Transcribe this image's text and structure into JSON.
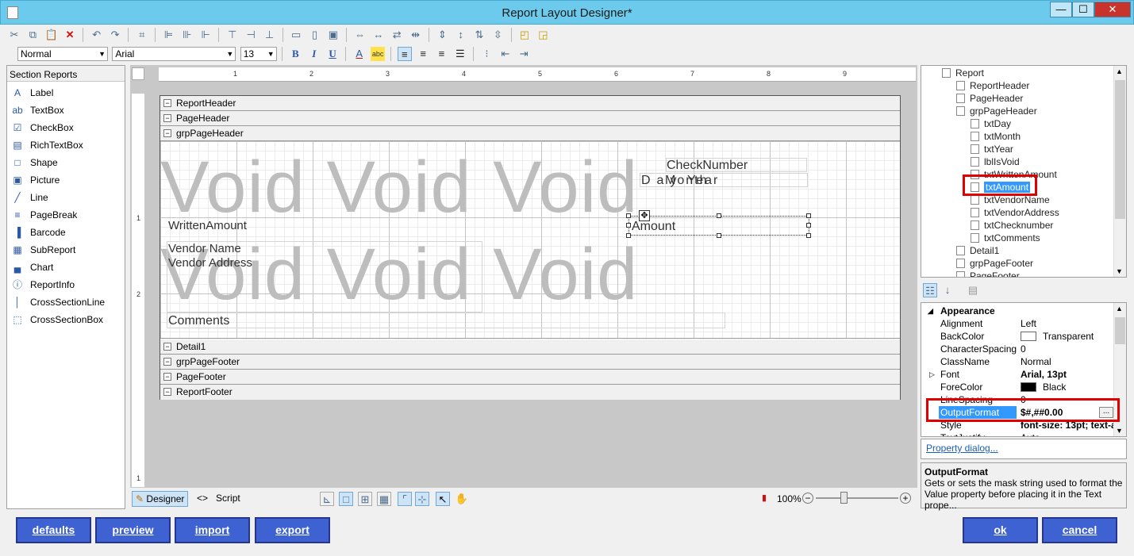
{
  "window": {
    "title": "Report Layout Designer*",
    "minimize": "—",
    "maximize": "☐",
    "close": "✕"
  },
  "format_bar": {
    "style": "Normal",
    "font": "Arial",
    "size": "13",
    "bold": "B",
    "italic": "I",
    "underline": "U"
  },
  "toolbox": {
    "header": "Section Reports",
    "items": [
      {
        "label": "Label",
        "icon": "label-icon",
        "glyph": "A"
      },
      {
        "label": "TextBox",
        "icon": "textbox-icon",
        "glyph": "ab"
      },
      {
        "label": "CheckBox",
        "icon": "checkbox-icon",
        "glyph": "☑"
      },
      {
        "label": "RichTextBox",
        "icon": "richtextbox-icon",
        "glyph": "▤"
      },
      {
        "label": "Shape",
        "icon": "shape-icon",
        "glyph": "□"
      },
      {
        "label": "Picture",
        "icon": "picture-icon",
        "glyph": "▣"
      },
      {
        "label": "Line",
        "icon": "line-icon",
        "glyph": "╱"
      },
      {
        "label": "PageBreak",
        "icon": "pagebreak-icon",
        "glyph": "≡"
      },
      {
        "label": "Barcode",
        "icon": "barcode-icon",
        "glyph": "▐"
      },
      {
        "label": "SubReport",
        "icon": "subreport-icon",
        "glyph": "▦"
      },
      {
        "label": "Chart",
        "icon": "chart-icon",
        "glyph": "▄"
      },
      {
        "label": "ReportInfo",
        "icon": "reportinfo-icon",
        "glyph": "ⓘ"
      },
      {
        "label": "CrossSectionLine",
        "icon": "crosssectionline-icon",
        "glyph": "│"
      },
      {
        "label": "CrossSectionBox",
        "icon": "crosssectionbox-icon",
        "glyph": "⬚"
      }
    ]
  },
  "ruler": {
    "marks": [
      "1",
      "2",
      "3",
      "4",
      "5",
      "6",
      "7",
      "8",
      "9"
    ],
    "left_marks": [
      "1",
      "2",
      "1"
    ]
  },
  "sections": {
    "report_header": "ReportHeader",
    "page_header": "PageHeader",
    "grp_page_header": "grpPageHeader",
    "detail": "Detail1",
    "grp_page_footer": "grpPageFooter",
    "page_footer": "PageFooter",
    "report_footer": "ReportFooter"
  },
  "canvas": {
    "void_line1": "Void Void Void",
    "void_line2": "Void Void Void",
    "check_number": "CheckNumber",
    "day": "Day",
    "month": "Month",
    "year": "Year",
    "written_amount": "WrittenAmount",
    "amount": "Amount",
    "vendor_name": "Vendor Name",
    "vendor_address": "Vendor Address",
    "comments": "Comments"
  },
  "designer_tabs": {
    "designer": "Designer",
    "script": "Script"
  },
  "zoom": {
    "level": "100%",
    "minus": "−",
    "plus": "+"
  },
  "tree": {
    "nodes": [
      {
        "label": "Report",
        "level": 0
      },
      {
        "label": "ReportHeader",
        "level": 1
      },
      {
        "label": "PageHeader",
        "level": 1
      },
      {
        "label": "grpPageHeader",
        "level": 1
      },
      {
        "label": "txtDay",
        "level": 2
      },
      {
        "label": "txtMonth",
        "level": 2
      },
      {
        "label": "txtYear",
        "level": 2
      },
      {
        "label": "lblIsVoid",
        "level": 2
      },
      {
        "label": "txtWrittenAmount",
        "level": 2
      },
      {
        "label": "txtAmount",
        "level": 2,
        "selected": true
      },
      {
        "label": "txtVendorName",
        "level": 2
      },
      {
        "label": "txtVendorAddress",
        "level": 2
      },
      {
        "label": "txtChecknumber",
        "level": 2
      },
      {
        "label": "txtComments",
        "level": 2
      },
      {
        "label": "Detail1",
        "level": 1
      },
      {
        "label": "grpPageFooter",
        "level": 1
      },
      {
        "label": "PageFooter",
        "level": 1
      }
    ]
  },
  "properties": {
    "category": "Appearance",
    "rows": [
      {
        "name": "Alignment",
        "value": "Left"
      },
      {
        "name": "BackColor",
        "value": "Transparent",
        "swatch": "#ffffff"
      },
      {
        "name": "CharacterSpacing",
        "value": "0"
      },
      {
        "name": "ClassName",
        "value": "Normal"
      },
      {
        "name": "Font",
        "value": "Arial, 13pt",
        "bold": true
      },
      {
        "name": "ForeColor",
        "value": "Black",
        "swatch": "#000000"
      },
      {
        "name": "LineSpacing",
        "value": "0"
      },
      {
        "name": "OutputFormat",
        "value": "$#,##0.00",
        "selected": true
      },
      {
        "name": "Style",
        "value": "font-size: 13pt; text-a",
        "bold": true
      },
      {
        "name": "TextJustify",
        "value": "Auto"
      }
    ],
    "ellipsis": "...",
    "link": "Property dialog...",
    "desc_title": "OutputFormat",
    "desc_text": "Gets or sets the mask string used to format the Value property before placing it in the Text prope..."
  },
  "buttons": {
    "defaults": "defaults",
    "preview": "preview",
    "import": "import",
    "export": "export",
    "ok": "ok",
    "cancel": "cancel"
  },
  "colors": {
    "accent": "#6ccbec",
    "button": "#3f62d3",
    "highlight": "#e00000",
    "selection": "#3399ff"
  }
}
